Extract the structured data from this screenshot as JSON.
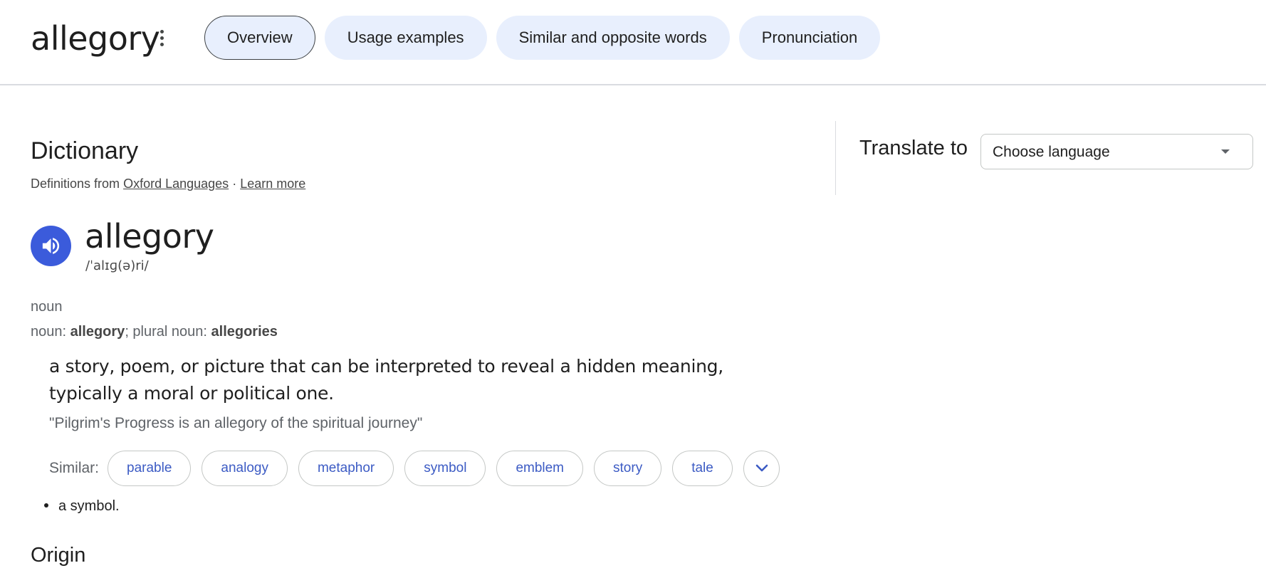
{
  "header": {
    "word": "allegory",
    "tabs": [
      {
        "label": "Overview",
        "active": true
      },
      {
        "label": "Usage examples",
        "active": false
      },
      {
        "label": "Similar and opposite words",
        "active": false
      },
      {
        "label": "Pronunciation",
        "active": false
      }
    ]
  },
  "dictionary": {
    "title": "Dictionary",
    "source_prefix": "Definitions from",
    "source_link": "Oxford Languages",
    "separator": "·",
    "learn_more": "Learn more",
    "headword": "allegory",
    "phonetic": "/ˈalɪɡ(ə)ri/",
    "part_of_speech": "noun",
    "forms": {
      "noun_label": "noun: ",
      "noun_value": "allegory",
      "plural_label": "; plural noun: ",
      "plural_value": "allegories"
    },
    "definition": "a story, poem, or picture that can be interpreted to reveal a hidden meaning, typically a moral or political one.",
    "example": "\"Pilgrim's Progress is an allegory of the spiritual journey\"",
    "similar_label": "Similar:",
    "similar": [
      "parable",
      "analogy",
      "metaphor",
      "symbol",
      "emblem",
      "story",
      "tale"
    ],
    "second_sense": "a symbol.",
    "origin_title": "Origin"
  },
  "translate": {
    "label": "Translate to",
    "placeholder": "Choose language"
  },
  "icons": {
    "more": "more-vert-icon",
    "speaker": "volume-up-icon",
    "expand": "chevron-down-icon",
    "dropdown": "caret-down-icon"
  },
  "colors": {
    "tab_bg": "#e8effd",
    "speaker_bg": "#3b5bdb",
    "chip_text": "#3c5bc4"
  }
}
